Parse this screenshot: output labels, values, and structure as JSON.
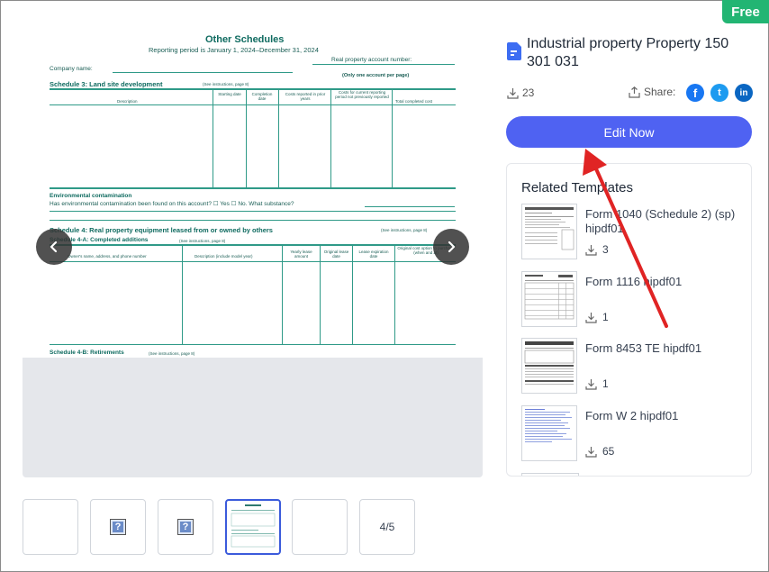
{
  "badge": "Free",
  "form": {
    "title": "Other Schedules",
    "period": "Reporting period is January 1, 2024–December 31, 2024",
    "account_label": "Real property account number:",
    "company_label": "Company name:",
    "account_note": "(Only one account per page)",
    "schedule3_title": "Schedule 3: Land site development",
    "schedule3_note": "(See instructions, page 8)",
    "columns3": [
      "Description",
      "Starting date",
      "Completion date",
      "Costs reported in prior years",
      "Costs for current reporting period not previously reported",
      "Total completed cost"
    ],
    "env_title": "Environmental contamination",
    "env_question": "Has environmental contamination been found on this account? ☐ Yes ☐ No. What substance?",
    "schedule4_title": "Schedule 4: Real property equipment leased from or owned by others",
    "schedule4_note": "(See instructions, page 8)",
    "schedule4a_title": "Schedule 4-A: Completed additions",
    "schedule4a_note": "(See instructions, page 8)",
    "columns4": [
      "Owner's name, address, and phone number",
      "Description (include model year)",
      "Yearly lease amount",
      "Original lease date",
      "Lease expiration date",
      "Original cost option to purchase (when and at)"
    ],
    "schedule4b_title": "Schedule 4-B: Retirements",
    "schedule4b_note": "(See instructions, page 8)"
  },
  "thumbnails": [
    {
      "type": "blank"
    },
    {
      "type": "question",
      "glyph": "?"
    },
    {
      "type": "question",
      "glyph": "?"
    },
    {
      "type": "form",
      "active": true
    },
    {
      "type": "blank"
    },
    {
      "type": "counter",
      "label": "4/5"
    }
  ],
  "template": {
    "title": "Industrial property Property 150 301 031",
    "downloads": "23",
    "share_label": "Share:",
    "edit_label": "Edit Now"
  },
  "social": [
    {
      "icon": "facebook-icon",
      "glyph": "f",
      "color": "#1877f2"
    },
    {
      "icon": "twitter-icon",
      "glyph": "t",
      "color": "#1d9bf0"
    },
    {
      "icon": "linkedin-icon",
      "glyph": "in",
      "color": "#0a66c2"
    }
  ],
  "related": {
    "heading": "Related Templates",
    "items": [
      {
        "name": "Form 1040 (Schedule 2) (sp) hipdf01",
        "downloads": "3"
      },
      {
        "name": "Form 1116 hipdf01",
        "downloads": "1"
      },
      {
        "name": "Form 8453 TE hipdf01",
        "downloads": "1"
      },
      {
        "name": "Form W 2 hipdf01",
        "downloads": "65"
      }
    ]
  },
  "colors": {
    "accent": "#4f62f2",
    "badge": "#22b573",
    "arrow": "#e02424",
    "form_green": "#0f6b60"
  }
}
